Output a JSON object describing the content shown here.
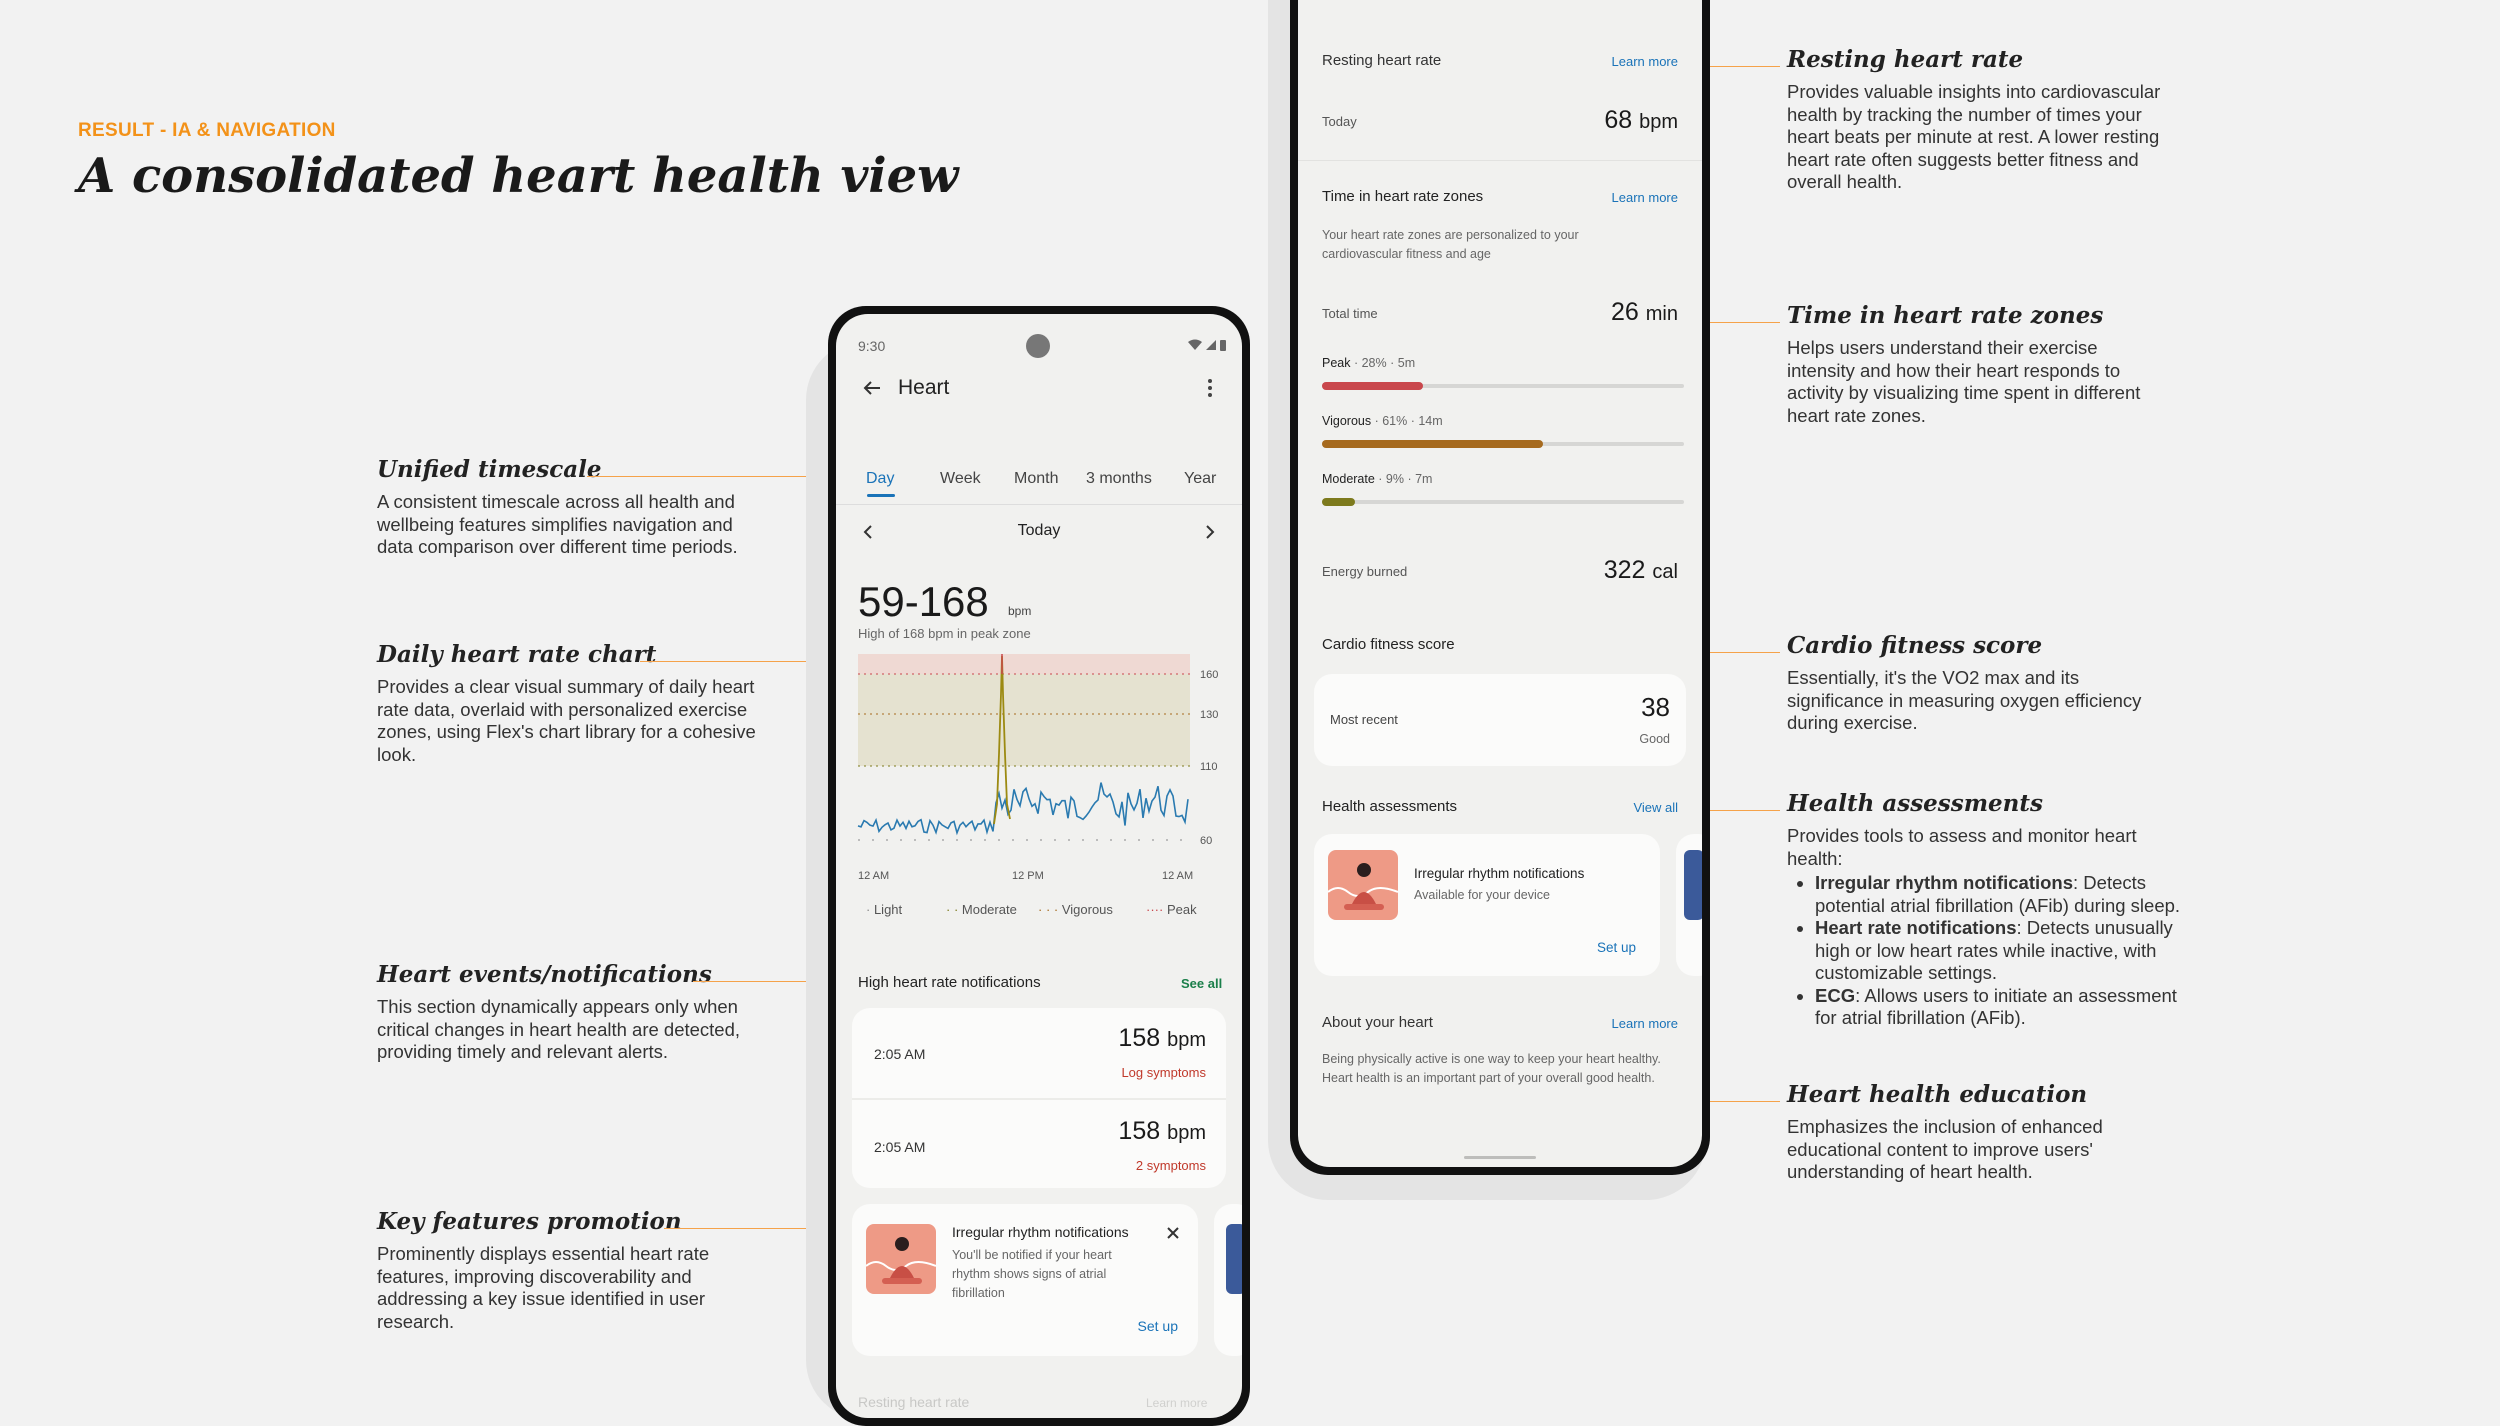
{
  "header": {
    "eyebrow": "RESULT - IA & NAVIGATION",
    "title": "A consolidated heart health view"
  },
  "annotations_left": [
    {
      "title": "Unified timescale",
      "text": "A consistent timescale across all health and wellbeing features simplifies navigation and data comparison over different time periods."
    },
    {
      "title": "Daily heart rate chart",
      "text": "Provides a clear visual summary of daily heart rate data, overlaid with personalized exercise zones, using Flex's chart library for a cohesive look."
    },
    {
      "title": "Heart events/notifications",
      "text": "This section dynamically appears only when critical changes in heart health are detected, providing timely and relevant alerts."
    },
    {
      "title": "Key features promotion",
      "text": "Prominently displays essential heart rate features, improving discoverability and addressing a key issue identified in user research."
    }
  ],
  "annotations_right": [
    {
      "title": "Resting heart rate",
      "text": "Provides valuable insights into cardiovascular health by tracking the number of times your heart beats per minute at rest. A lower resting heart rate often suggests better fitness and overall health."
    },
    {
      "title": "Time in heart rate zones",
      "text": "Helps users understand their exercise intensity and how their heart responds to activity by visualizing time spent in different heart rate zones."
    },
    {
      "title": "Cardio fitness score",
      "text": "Essentially, it's the VO2 max and its significance in measuring oxygen efficiency during exercise."
    },
    {
      "title": "Health assessments",
      "text": "Provides tools to assess and monitor heart health:",
      "bullets": [
        {
          "bold": "Irregular rhythm notifications",
          "rest": ": Detects potential atrial fibrillation (AFib) during sleep."
        },
        {
          "bold": "Heart rate notifications",
          "rest": ": Detects unusually high or low heart rates while inactive, with customizable settings."
        },
        {
          "bold": "ECG",
          "rest": ": Allows users to initiate an assessment for atrial fibrillation (AFib)."
        }
      ]
    },
    {
      "title": "Heart health education",
      "text": "Emphasizes the inclusion of enhanced educational content to improve users' understanding of heart health."
    }
  ],
  "phone1": {
    "status_time": "9:30",
    "app_title": "Heart",
    "tabs": [
      "Day",
      "Week",
      "Month",
      "3 months",
      "Year"
    ],
    "active_tab": "Day",
    "date_label": "Today",
    "range": "59-168",
    "range_unit": "bpm",
    "range_sub": "High of 168 bpm in peak zone",
    "chart_ticks_y": [
      "160",
      "130",
      "110",
      "60"
    ],
    "chart_ticks_x": [
      "12 AM",
      "12 PM",
      "12 AM"
    ],
    "legend": [
      "Light",
      "Moderate",
      "Vigorous",
      "Peak"
    ],
    "notif_header": "High heart rate notifications",
    "see_all": "See all",
    "notifs": [
      {
        "time": "2:05 AM",
        "value": "158",
        "unit": "bpm",
        "action": "Log symptoms"
      },
      {
        "time": "2:05 AM",
        "value": "158",
        "unit": "bpm",
        "action": "2 symptoms"
      }
    ],
    "promo": {
      "title": "Irregular rhythm notifications",
      "body": "You'll be notified if your heart rhythm shows signs of atrial fibrillation",
      "cta": "Set up"
    },
    "cut_label": "Resting heart rate",
    "cut_link": "Learn more",
    "colors": {
      "accent": "#1a73b8",
      "zone_fill": "#e5e2d0",
      "peak_fill": "#efd9d3",
      "line": "#2a7ab0",
      "spike": "#9c8a12"
    }
  },
  "phone2": {
    "resting": {
      "label": "Resting heart rate",
      "link": "Learn more",
      "today": "Today",
      "value": "68",
      "unit": "bpm"
    },
    "zones": {
      "label": "Time in heart rate zones",
      "link": "Learn more",
      "desc": "Your heart rate zones are personalized to your cardiovascular fitness and age",
      "total_label": "Total time",
      "total_value": "26",
      "total_unit": "min",
      "items": [
        {
          "name": "Peak",
          "detail": "28% · 5m",
          "pct": 0.28,
          "color": "#c9474c"
        },
        {
          "name": "Vigorous",
          "detail": "61% · 14m",
          "pct": 0.61,
          "color": "#a66a1e"
        },
        {
          "name": "Moderate",
          "detail": "9% · 7m",
          "pct": 0.09,
          "color": "#7d7a1d"
        }
      ]
    },
    "energy": {
      "label": "Energy burned",
      "value": "322",
      "unit": "cal"
    },
    "cardio": {
      "label": "Cardio fitness score",
      "recent": "Most recent",
      "value": "38",
      "rating": "Good"
    },
    "assess": {
      "label": "Health assessments",
      "link": "View all",
      "card_title": "Irregular rhythm notifications",
      "card_sub": "Available for your device",
      "cta": "Set up"
    },
    "about": {
      "label": "About your heart",
      "link": "Learn more",
      "text": "Being physically active is one way to keep your heart healthy. Heart health is an important part of your overall good health."
    }
  }
}
